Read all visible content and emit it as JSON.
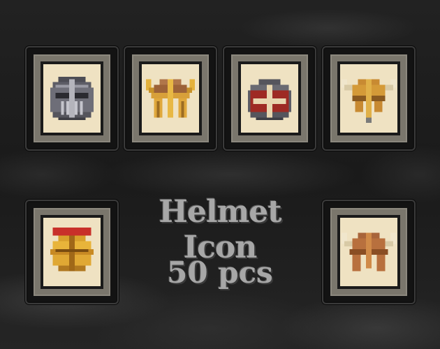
{
  "title": "Helmet Icon",
  "count": "50 pcs",
  "colors": {
    "paper": "#efe2c2",
    "frame": "#7a766c",
    "card": "#131313",
    "text": "#a7a7a7"
  },
  "helmets": [
    {
      "icon": "closed-steel-helmet-icon"
    },
    {
      "icon": "horned-bronze-helmet-icon"
    },
    {
      "icon": "red-cross-helm-icon"
    },
    {
      "icon": "viking-horned-helmet-icon"
    },
    {
      "icon": "crested-golden-helmet-icon"
    },
    {
      "icon": "horned-leather-helmet-icon"
    }
  ]
}
